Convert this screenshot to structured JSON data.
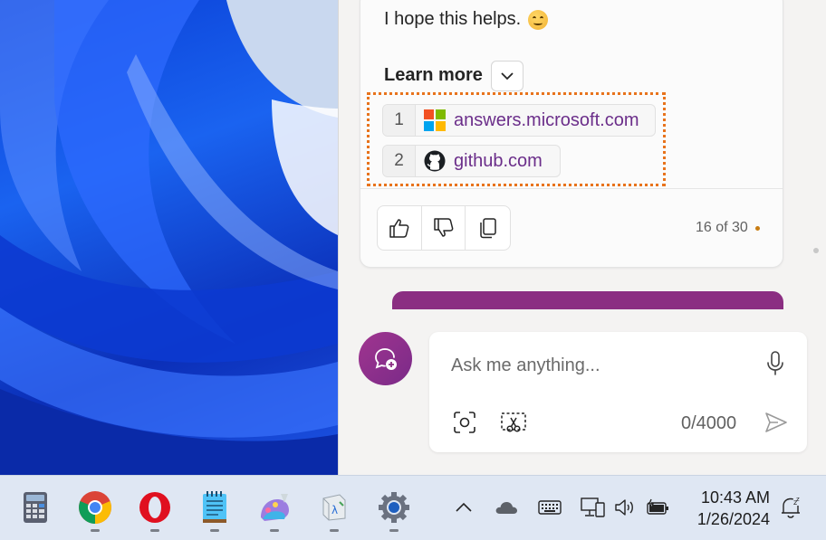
{
  "chat": {
    "message_text": "I hope this helps.",
    "emoji": "smiling-face-icon",
    "learn_more_label": "Learn more",
    "sources": [
      {
        "num": "1",
        "site": "answers.microsoft.com",
        "icon": "microsoft-logo-icon"
      },
      {
        "num": "2",
        "site": "github.com",
        "icon": "github-logo-icon"
      }
    ],
    "response_counter": "16 of 30"
  },
  "composer": {
    "placeholder": "Ask me anything...",
    "char_count": "0/4000"
  },
  "taskbar": {
    "apps": [
      "calculator-icon",
      "chrome-icon",
      "opera-icon",
      "notepad-icon",
      "paint-icon",
      "terminal-icon",
      "settings-icon"
    ],
    "time": "10:43 AM",
    "date": "1/26/2024"
  },
  "colors": {
    "accent_purple": "#8b2e82",
    "link_purple": "#6b2e8a",
    "highlight_orange": "#e8731c",
    "taskbar_bg": "#dfe7f3"
  }
}
